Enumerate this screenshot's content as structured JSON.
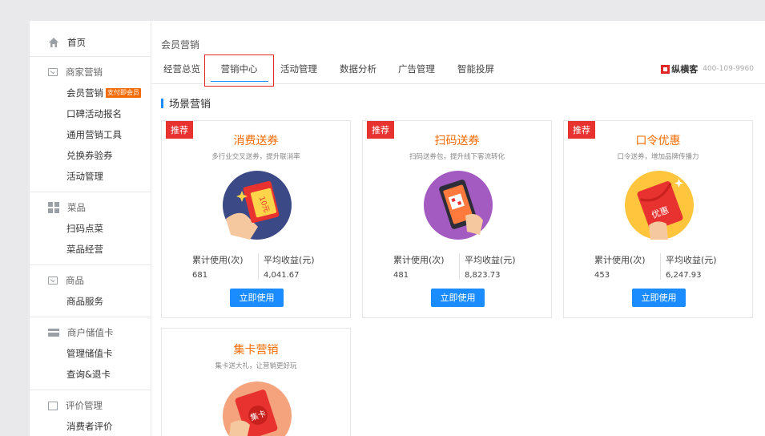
{
  "sidebar": {
    "home": "首页",
    "merchant_marketing": {
      "title": "商家营销",
      "items": [
        "会员营销",
        "口碑活动报名",
        "通用营销工具",
        "兑换券验券",
        "活动管理"
      ],
      "badge": "支付即会员"
    },
    "dishes": {
      "title": "菜品",
      "items": [
        "扫码点菜",
        "菜品经营"
      ]
    },
    "goods": {
      "title": "商品",
      "items": [
        "商品服务"
      ]
    },
    "stored_card": {
      "title": "商户储值卡",
      "items": [
        "管理储值卡",
        "查询&退卡"
      ]
    },
    "reviews": {
      "title": "评价管理",
      "items": [
        "消费者评价"
      ]
    }
  },
  "header": {
    "breadcrumb": "会员营销",
    "tabs": [
      "经营总览",
      "营销中心",
      "活动管理",
      "数据分析",
      "广告管理",
      "智能投屏"
    ],
    "active_tab": "营销中心",
    "brand": "纵横客",
    "phone": "400-109-9960"
  },
  "section": {
    "title": "场景营销"
  },
  "cards": [
    {
      "tag": "推荐",
      "title": "消费送券",
      "subtitle": "多行业交叉送券，提升联消率",
      "stat1_label": "累计使用(次)",
      "stat1_value": "681",
      "stat2_label": "平均收益(元)",
      "stat2_value": "4,041.67",
      "button": "立即使用",
      "coupon_text": "10元"
    },
    {
      "tag": "推荐",
      "title": "扫码送券",
      "subtitle": "扫码送券包，提升线下客流转化",
      "stat1_label": "累计使用(次)",
      "stat1_value": "481",
      "stat2_label": "平均收益(元)",
      "stat2_value": "8,823.73",
      "button": "立即使用"
    },
    {
      "tag": "推荐",
      "title": "口令优惠",
      "subtitle": "口令送券，增加品牌传播力",
      "stat1_label": "累计使用(次)",
      "stat1_value": "453",
      "stat2_label": "平均收益(元)",
      "stat2_value": "6,247.93",
      "button": "立即使用",
      "envelope_text": "优惠"
    },
    {
      "title": "集卡营销",
      "subtitle": "集卡送大礼，让营销更好玩",
      "card_text": "集卡"
    }
  ],
  "colors": {
    "accent_blue": "#1a8cff",
    "orange": "#f56a00",
    "red_tag": "#e8322f",
    "highlight_red": "#e12828"
  }
}
